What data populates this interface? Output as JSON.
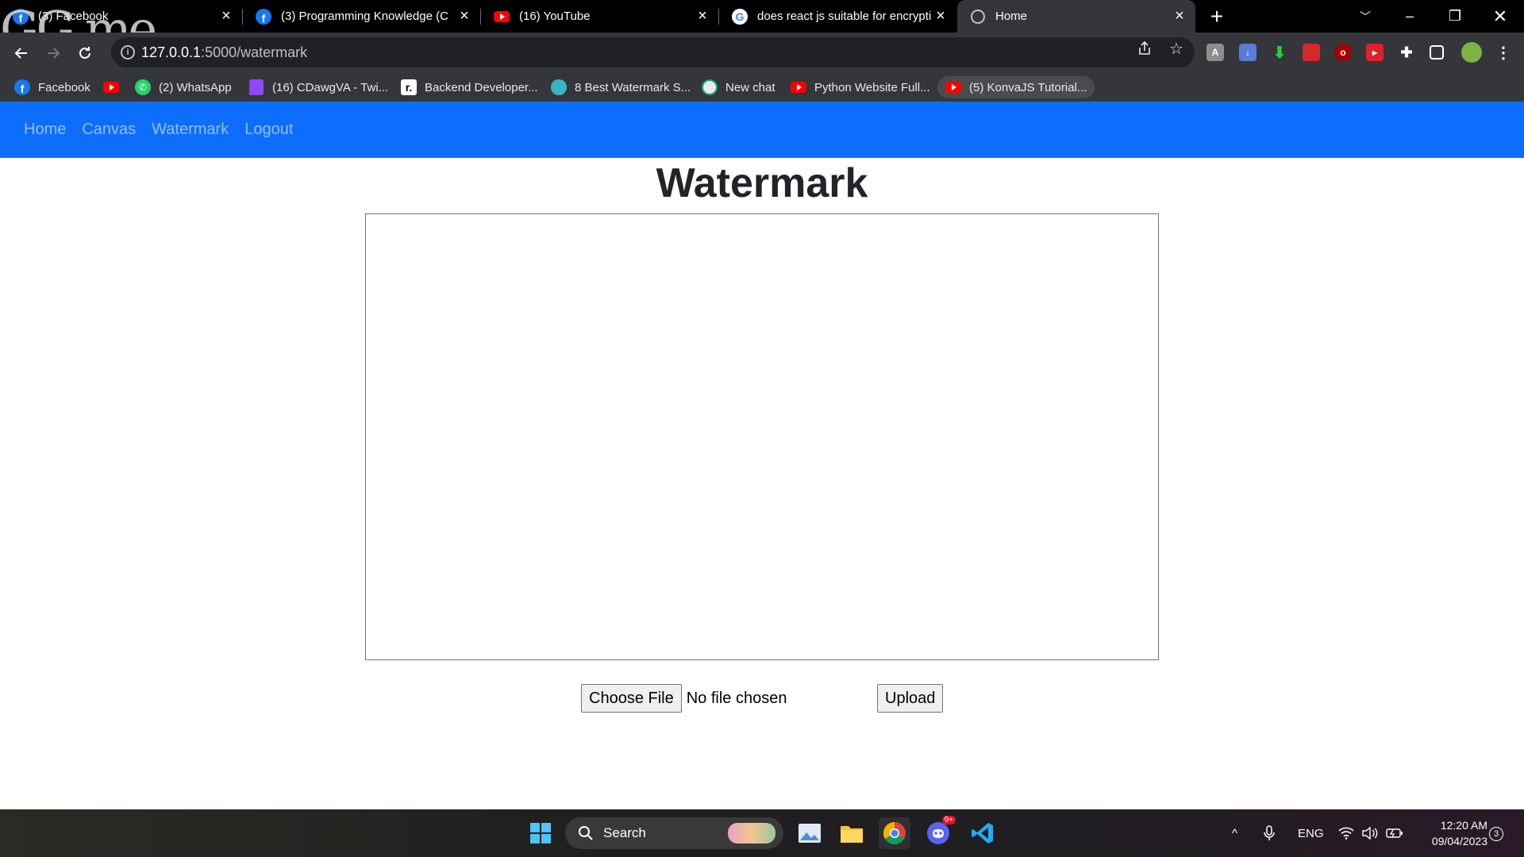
{
  "browser": {
    "tabs": [
      {
        "title": "(3) Facebook",
        "icon": "facebook-icon",
        "active": false
      },
      {
        "title": "(3) Programming Knowledge (C",
        "icon": "facebook-icon",
        "active": false
      },
      {
        "title": "(16) YouTube",
        "icon": "youtube-icon",
        "active": false
      },
      {
        "title": "does react js suitable for encrypti",
        "icon": "google-icon",
        "active": false
      },
      {
        "title": "Home",
        "icon": "globe-icon",
        "active": true
      }
    ],
    "overlay_logo": "GG me",
    "url_host": "127.0.0.1",
    "url_path": ":5000/watermark",
    "bookmarks": [
      {
        "label": "Facebook",
        "icon": "facebook-icon"
      },
      {
        "label": "",
        "icon": "youtube-icon"
      },
      {
        "label": "(2) WhatsApp",
        "icon": "whatsapp-icon"
      },
      {
        "label": "(16) CDawgVA - Twi...",
        "icon": "twitch-icon"
      },
      {
        "label": "Backend Developer...",
        "icon": "roadmap-icon"
      },
      {
        "label": "8 Best Watermark S...",
        "icon": "watermark-site-icon"
      },
      {
        "label": "New chat",
        "icon": "chatgpt-icon"
      },
      {
        "label": "Python Website Full...",
        "icon": "youtube-icon"
      },
      {
        "label": "(5) KonvaJS Tutorial...",
        "icon": "youtube-icon"
      }
    ]
  },
  "site": {
    "nav": [
      "Home",
      "Canvas",
      "Watermark",
      "Logout"
    ],
    "heading": "Watermark",
    "choose_file_label": "Choose File",
    "no_file_text": "No file chosen",
    "upload_label": "Upload"
  },
  "taskbar": {
    "search_label": "Search",
    "language": "ENG",
    "time": "12:20 AM",
    "date": "09/04/2023",
    "notification_count": "3",
    "discord_badge": "9+"
  },
  "colors": {
    "navbar": "#0d6efd",
    "chrome_dark": "#35363a",
    "tabstrip": "#000000"
  }
}
